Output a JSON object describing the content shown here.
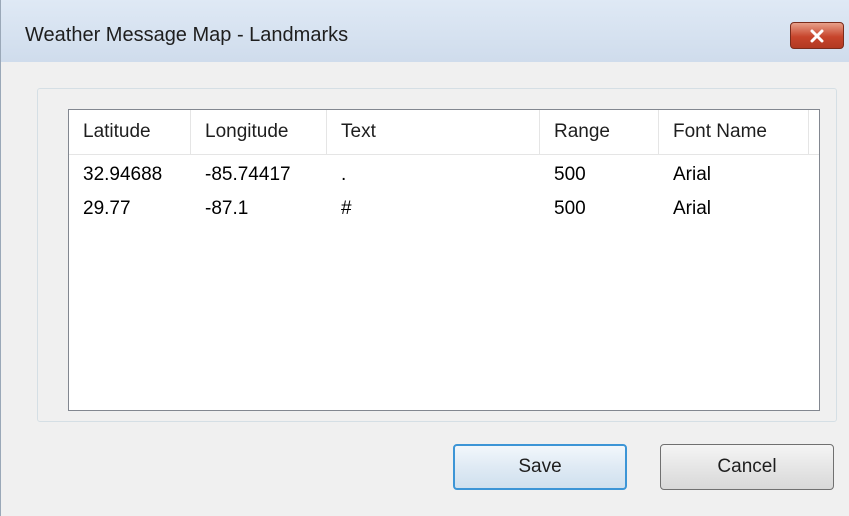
{
  "window": {
    "title": "Weather Message Map - Landmarks"
  },
  "table": {
    "columns": [
      "Latitude",
      "Longitude",
      "Text",
      "Range",
      "Font Name"
    ],
    "rows": [
      [
        "32.94688",
        "-85.74417",
        ".",
        "500",
        "Arial"
      ],
      [
        "29.77",
        "-87.1",
        "#",
        "500",
        "Arial"
      ]
    ]
  },
  "buttons": {
    "save": "Save",
    "cancel": "Cancel"
  },
  "icons": {
    "close": "close-icon"
  },
  "colors": {
    "close_button": "#c7452c",
    "default_button_border": "#3c95d6"
  }
}
